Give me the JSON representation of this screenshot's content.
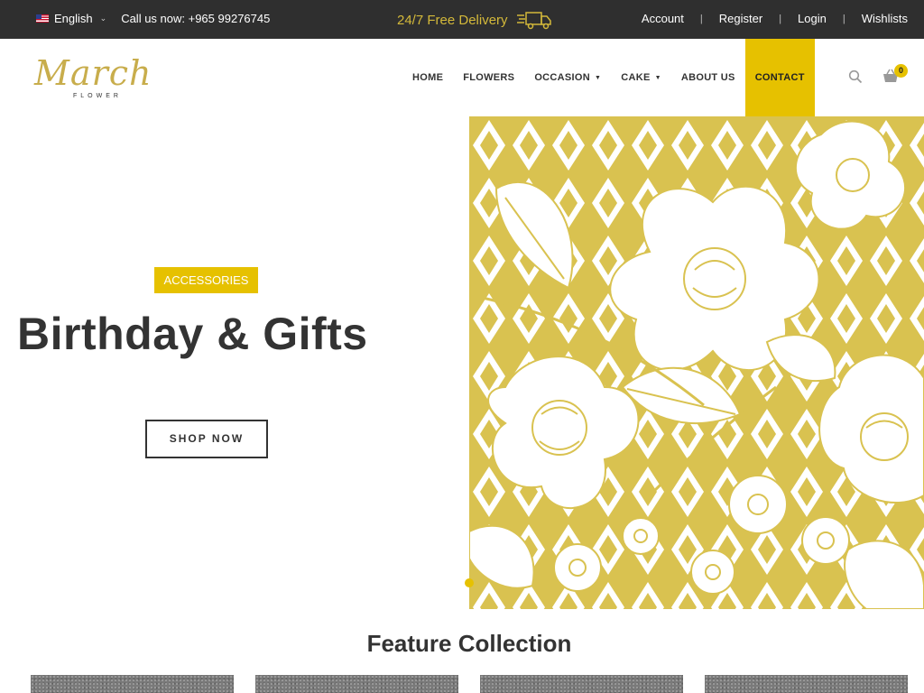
{
  "topbar": {
    "language": "English",
    "call_text": "Call us now: +965 99276745",
    "delivery_text": "24/7 Free Delivery",
    "links": [
      "Account",
      "Register",
      "Login",
      "Wishlists"
    ]
  },
  "header": {
    "logo_script": "March",
    "logo_sub": "FLOWER",
    "nav": [
      {
        "label": "HOME"
      },
      {
        "label": "FLOWERS"
      },
      {
        "label": "OCCASION",
        "dropdown": true
      },
      {
        "label": "CAKE",
        "dropdown": true
      },
      {
        "label": "ABOUT US"
      },
      {
        "label": "CONTACT",
        "active": true
      }
    ],
    "cart_count": "0",
    "icons": [
      "search-icon",
      "cart-icon",
      "truck-icon",
      "flag-icon"
    ]
  },
  "hero": {
    "tag": "ACCESSORIES",
    "title": "Birthday & Gifts",
    "button": "SHOP NOW"
  },
  "feature": {
    "title": "Feature Collection"
  },
  "colors": {
    "accent": "#e6c100",
    "pattern": "#d9c250",
    "dark": "#2f2f2f",
    "text": "#333333"
  }
}
